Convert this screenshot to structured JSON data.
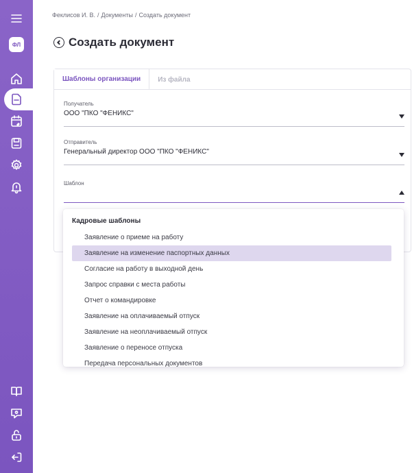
{
  "colors": {
    "accent": "#7b55bf",
    "selected_bg": "#ded7ee"
  },
  "sidebar": {
    "avatar_initials": "ФЛ",
    "icons": [
      "menu-icon",
      "home-icon",
      "document-icon",
      "calendar-icon",
      "save-icon",
      "gear-icon",
      "bell-icon",
      "book-icon",
      "chat-icon",
      "lock-icon",
      "logout-icon"
    ]
  },
  "breadcrumb": {
    "items": [
      "Феклисов И. В.",
      "Документы",
      "Создать документ"
    ],
    "separator": "/"
  },
  "page": {
    "title": "Создать документ"
  },
  "tabs": [
    {
      "label": "Шаблоны организации",
      "active": true
    },
    {
      "label": "Из файла",
      "active": false
    }
  ],
  "form": {
    "recipient": {
      "label": "Получатель",
      "value": "ООО \"ПКО \"ФЕНИКС\""
    },
    "sender": {
      "label": "Отправитель",
      "value": "Генеральный директор ООО \"ПКО \"ФЕНИКС\""
    },
    "template": {
      "label": "Шаблон",
      "value": ""
    }
  },
  "dropdown": {
    "group_label": "Кадровые шаблоны",
    "items": [
      "Заявление о приеме на работу",
      "Заявление на изменение паспортных данных",
      "Согласие на работу в выходной день",
      "Запрос справки с места работы",
      "Отчет о командировке",
      "Заявление на оплачиваемый отпуск",
      "Заявление на неоплачиваемый отпуск",
      "Заявление о переносе отпуска",
      "Передача персональных документов"
    ],
    "selected_index": 1
  }
}
